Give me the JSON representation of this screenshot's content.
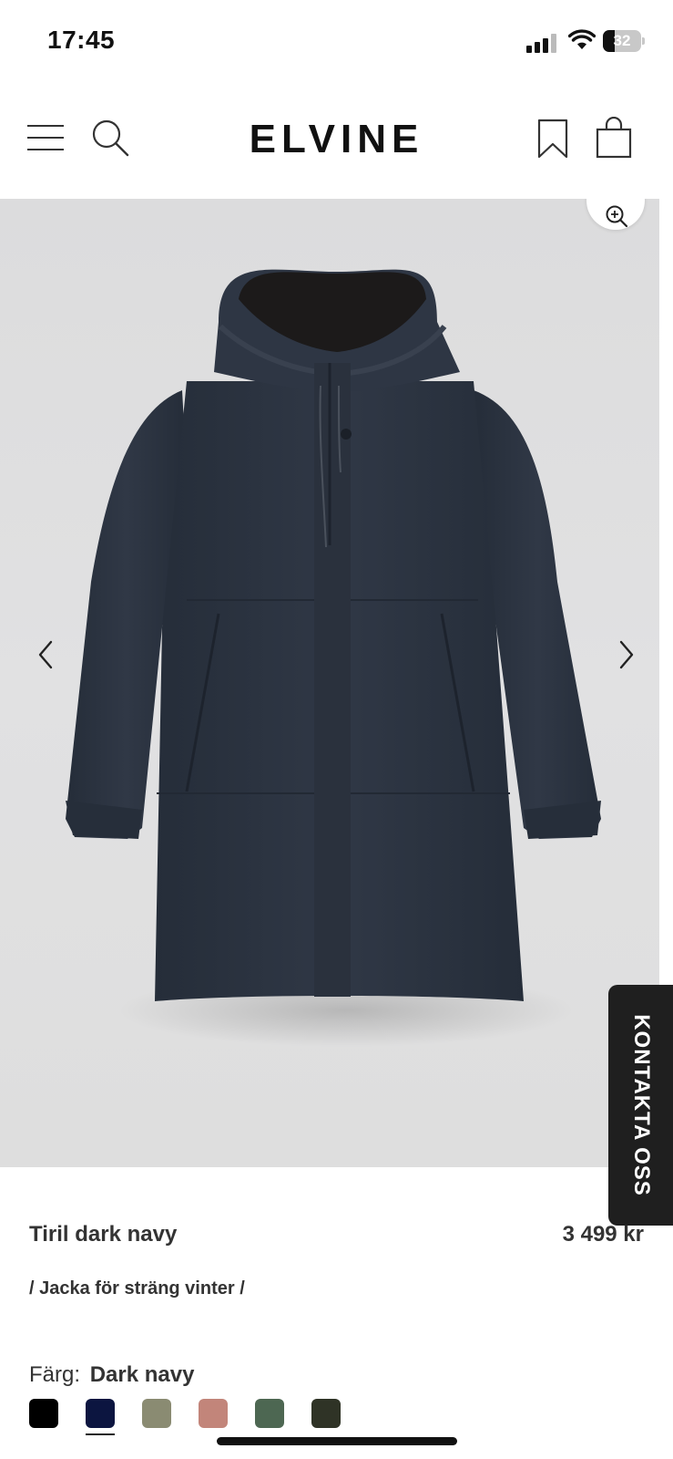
{
  "status_bar": {
    "time": "17:45",
    "battery": "32",
    "battery_level": 0.32
  },
  "header": {
    "logo": "ELVINE",
    "icons": [
      "menu-icon",
      "search-icon",
      "bookmark-icon",
      "shopping-bag-icon"
    ]
  },
  "gallery": {
    "icons": [
      "zoom-in-icon",
      "chevron-left-icon",
      "chevron-right-icon"
    ]
  },
  "contact_tab": {
    "label": "KONTAKTA OSS"
  },
  "product": {
    "name": "Tiril dark navy",
    "price": "3 499 kr",
    "subtitle": "/ Jacka för sträng vinter /",
    "color_label": "Färg:",
    "color_value": "Dark navy",
    "swatches": [
      {
        "color": "#000000",
        "selected": false
      },
      {
        "color": "#0c1540",
        "selected": true
      },
      {
        "color": "#8a8b72",
        "selected": false
      },
      {
        "color": "#c2857a",
        "selected": false
      },
      {
        "color": "#4d6752",
        "selected": false
      },
      {
        "color": "#2f3326",
        "selected": false
      }
    ]
  },
  "colors": {
    "coat": "#2c3441",
    "coat_shadow": "#232a36",
    "lining": "#1c1a1a",
    "contact_bg": "#1f1f1f"
  }
}
